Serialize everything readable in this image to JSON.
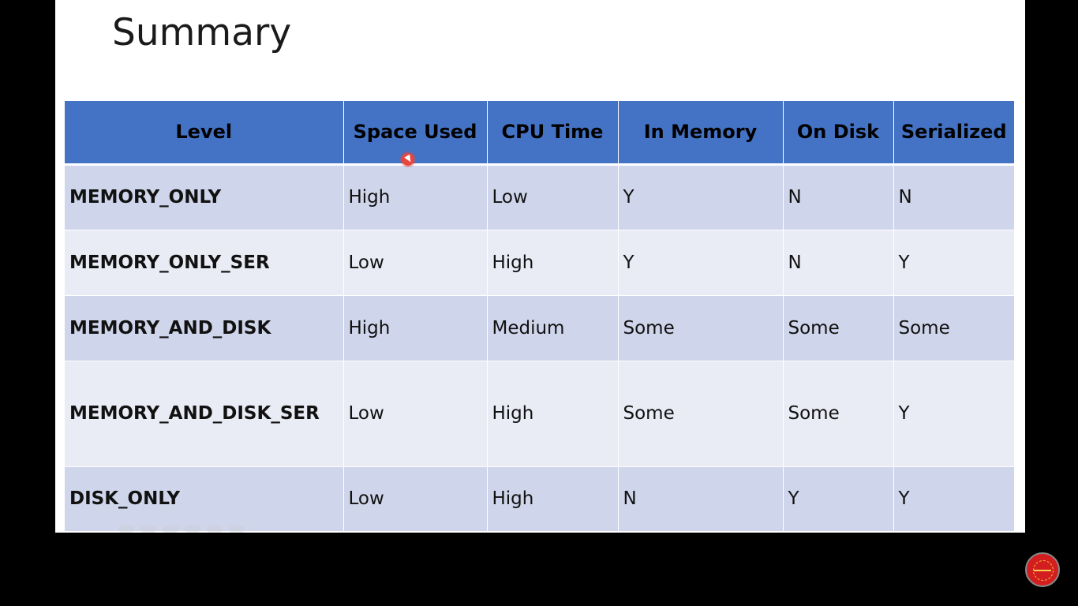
{
  "slide": {
    "title": "Summary"
  },
  "table": {
    "headers": [
      "Level",
      "Space Used",
      "CPU Time",
      "In Memory",
      "On Disk",
      "Serialized"
    ],
    "rows": [
      {
        "level": "MEMORY_ONLY",
        "space": "High",
        "cpu": "Low",
        "memory": "Y",
        "disk": "N",
        "serialized": "N"
      },
      {
        "level": "MEMORY_ONLY_SER",
        "space": "Low",
        "cpu": "High",
        "memory": "Y",
        "disk": "N",
        "serialized": "Y"
      },
      {
        "level": "MEMORY_AND_DISK",
        "space": "High",
        "cpu": "Medium",
        "memory": "Some",
        "disk": "Some",
        "serialized": "Some"
      },
      {
        "level": "MEMORY_AND_DISK_SER",
        "space": "Low",
        "cpu": "High",
        "memory": "Some",
        "disk": "Some",
        "serialized": "Y"
      },
      {
        "level": "DISK_ONLY",
        "space": "Low",
        "cpu": "High",
        "memory": "N",
        "disk": "Y",
        "serialized": "Y"
      }
    ]
  },
  "colors": {
    "background": "#000000",
    "slide": "#ffffff",
    "header": "#4472c4",
    "row_odd": "#cfd5ea",
    "row_even": "#e9ebf5",
    "cursor": "#e8463f",
    "logo": "#d21e1e"
  },
  "icons": {
    "cursor": "pointer-cursor-icon",
    "logo": "channel-logo-icon"
  }
}
